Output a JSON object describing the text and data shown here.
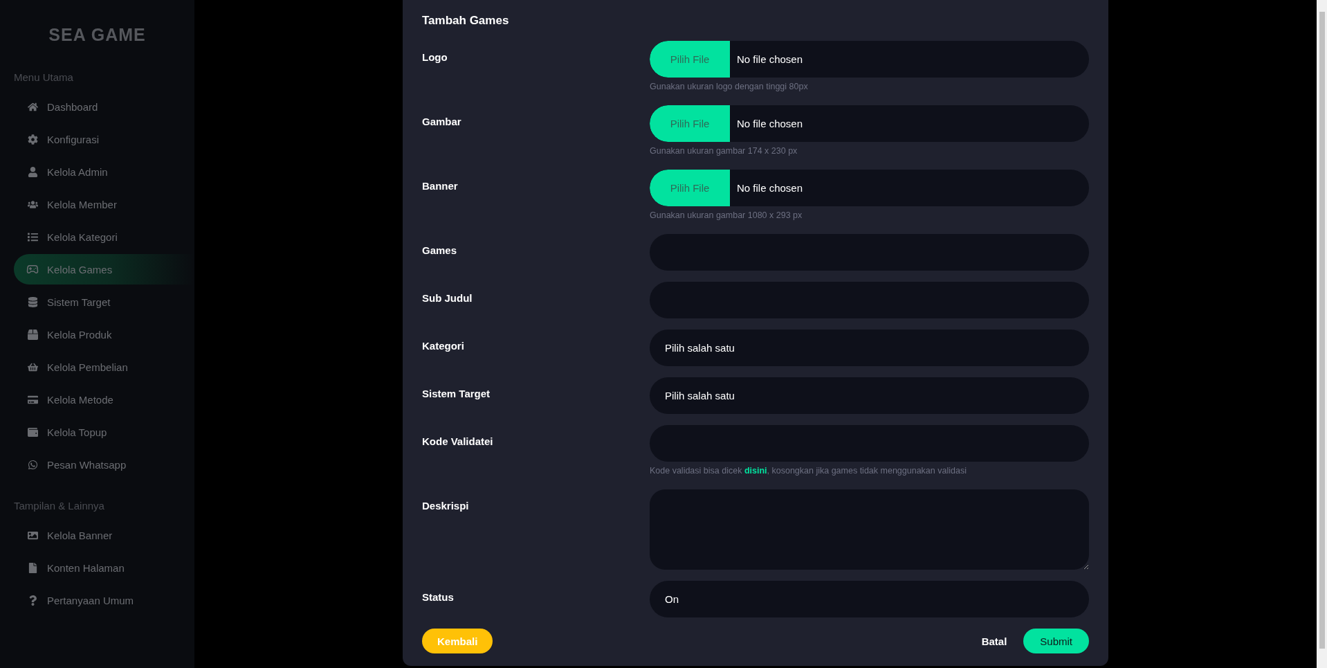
{
  "sidebar": {
    "logo": "SEA GAME",
    "sections": [
      {
        "title": "Menu Utama",
        "items": [
          {
            "label": "Dashboard",
            "selected": false
          },
          {
            "label": "Konfigurasi",
            "selected": false
          },
          {
            "label": "Kelola Admin",
            "selected": false
          },
          {
            "label": "Kelola Member",
            "selected": false
          },
          {
            "label": "Kelola Kategori",
            "selected": false
          },
          {
            "label": "Kelola Games",
            "selected": true
          },
          {
            "label": "Sistem Target",
            "selected": false
          },
          {
            "label": "Kelola Produk",
            "selected": false
          },
          {
            "label": "Kelola Pembelian",
            "selected": false
          },
          {
            "label": "Kelola Metode",
            "selected": false
          },
          {
            "label": "Kelola Topup",
            "selected": false
          },
          {
            "label": "Pesan Whatsapp",
            "selected": false
          }
        ]
      },
      {
        "title": "Tampilan & Lainnya",
        "items": [
          {
            "label": "Kelola Banner",
            "selected": false
          },
          {
            "label": "Konten Halaman",
            "selected": false
          },
          {
            "label": "Pertanyaan Umum",
            "selected": false
          }
        ]
      }
    ]
  },
  "modal": {
    "title": "Tambah Games",
    "fields": [
      {
        "label": "Logo",
        "kind": "file",
        "button": "Pilih File",
        "value": "No file chosen",
        "hint": "Gunakan ukuran logo dengan tinggi 80px"
      },
      {
        "label": "Gambar",
        "kind": "file",
        "button": "Pilih File",
        "value": "No file chosen",
        "hint": "Gunakan ukuran gambar 174 x 230 px"
      },
      {
        "label": "Banner",
        "kind": "file",
        "button": "Pilih File",
        "value": "No file chosen",
        "hint": "Gunakan ukuran gambar 1080 x 293 px"
      },
      {
        "label": "Games",
        "kind": "text"
      },
      {
        "label": "Sub Judul",
        "kind": "text"
      },
      {
        "label": "Kategori",
        "kind": "select",
        "value": "Pilih salah satu"
      },
      {
        "label": "Sistem Target",
        "kind": "select",
        "value": "Pilih salah satu"
      },
      {
        "label": "Kode Validatei",
        "kind": "text",
        "hint_link": {
          "before": "Kode validasi bisa dicek ",
          "link": "disini",
          "after": ", kosongkan jika games tidak menggunakan validasi"
        }
      },
      {
        "label": "Deskrispi",
        "kind": "textarea"
      },
      {
        "label": "Status",
        "kind": "select",
        "value": "On"
      }
    ],
    "back_button": "Kembali",
    "cancel_button": "Batal",
    "submit_button": "Submit"
  }
}
